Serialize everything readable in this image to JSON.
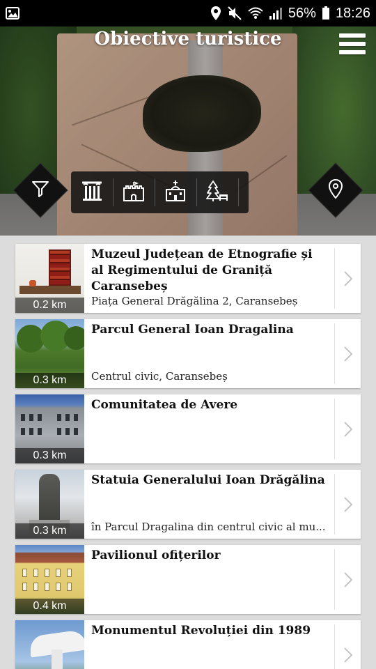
{
  "status_bar": {
    "battery": "56%",
    "time": "18:26"
  },
  "header": {
    "title": "Obiective turistice"
  },
  "categories": [
    {
      "icon": "columns-icon"
    },
    {
      "icon": "castle-icon"
    },
    {
      "icon": "church-icon"
    },
    {
      "icon": "tree-bench-icon"
    }
  ],
  "places": [
    {
      "name": "Muzeul Județean de Etnografie și al Regimentului de Graniță Caransebeș",
      "address": "Piața General Drăgălina 2, Caransebeș",
      "distance": "0.2 km"
    },
    {
      "name": "Parcul General Ioan Dragalina",
      "address": "Centrul civic, Caransebeș",
      "distance": "0.3 km"
    },
    {
      "name": "Comunitatea de Avere",
      "address": "",
      "distance": "0.3 km"
    },
    {
      "name": "Statuia Generalului Ioan Drăgălina",
      "address": "în Parcul Dragalina din centrul civic al mu...",
      "distance": "0.3 km"
    },
    {
      "name": "Pavilionul ofițerilor",
      "address": "",
      "distance": "0.4 km"
    },
    {
      "name": "Monumentul Revoluției din 1989",
      "address": "",
      "distance": ""
    }
  ],
  "colors": {
    "status_bg": "#000000",
    "list_bg": "#dcdcdc",
    "card_bg": "#ffffff",
    "control_bg": "#111111"
  }
}
